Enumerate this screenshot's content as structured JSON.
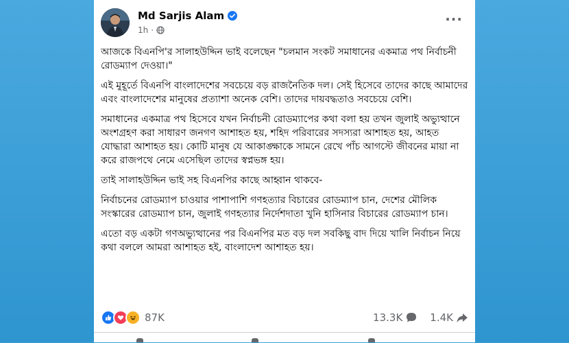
{
  "post": {
    "author_name": "Md Sarjis Alam",
    "timestamp": "1h",
    "paragraphs": [
      "আজকে বিএনপি'র সালাহউদ্দিন ভাই বলেছেন \"চলমান সংকট সমাধানের একমাত্র পথ নির্বাচনী রোডম্যাপ দেওয়া।\"",
      "এই মুহূর্তে বিএনপি বাংলাদেশের সবচেয়ে বড় রাজনৈতিক দল। সেই হিসেবে তাদের কাছে আমাদের এবং বাংলাদেশের মানুষের প্রত্যাশা অনেক বেশি। তাদের দায়বদ্ধতাও সবচেয়ে বেশি।",
      "সমাধানের একমাত্র পথ হিসেবে যখন নির্বাচনী রোডম্যাপের কথা বলা হয় তখন জুলাই অভ্যুত্থানে অংশগ্রহণ করা সাধারণ জনগণ আশাহত হয়, শহিদ পরিবারের সদস্যরা আশাহত হয়, আহত যোদ্ধারা আশাহত হয়। কোটি মানুষ যে আকাঙ্ক্ষাকে সামনে রেখে পাঁচ আগস্টে জীবনের মায়া না করে রাজপথে নেমে এসেছিল তাদের স্বপ্নভঙ্গ হয়।",
      "তাই সালাহউদ্দিন ভাই সহ বিএনপির কাছে আহ্বান থাকবে-",
      "নির্বাচনের রোডম্যাপ চাওয়ার পাশাপাশি গণহত্যার বিচারের রোডম্যাপ চান, দেশের মৌলিক সংস্কারের রোডম্যাপ চান, জুলাই গণহত্যার নির্দেশদাতা খুনি হাসিনার বিচারের রোডম্যাপ চান।",
      "এতো বড় একটা গণঅভ্যুত্থানের পর বিএনপির মত বড় দল সবকিছু বাদ দিয়ে খালি নির্বাচন নিয়ে কথা বললে আমরা আশাহত হই, বাংলাদেশ আশাহত হয়।"
    ]
  },
  "stats": {
    "reactions_count": "87K",
    "comments_count": "13.3K",
    "shares_count": "1.4K"
  },
  "icons": {
    "verified": "verified-badge-icon",
    "privacy": "globe-icon",
    "more": "more-options-icon",
    "like": "like-reaction-icon",
    "love": "love-reaction-icon",
    "haha": "haha-reaction-icon",
    "comment": "comment-icon",
    "share": "share-icon"
  },
  "colors": {
    "background": "#3aa0d8",
    "card": "#ffffff",
    "like_blue": "#1877f2",
    "love_red": "#f33e58",
    "haha_yellow": "#f7b125",
    "secondary_text": "#65676b"
  }
}
